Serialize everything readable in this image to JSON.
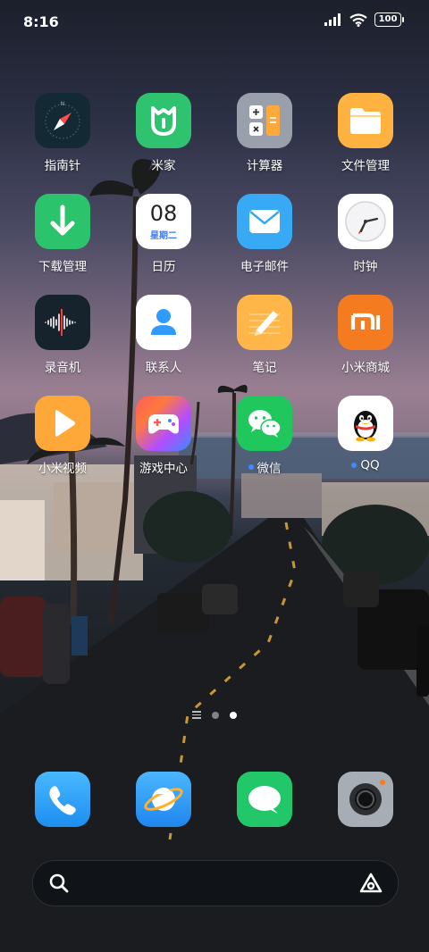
{
  "status_bar": {
    "time": "8:16",
    "battery": "100"
  },
  "apps": [
    {
      "label": "指南针",
      "icon": "compass-icon"
    },
    {
      "label": "米家",
      "icon": "mijia-icon"
    },
    {
      "label": "计算器",
      "icon": "calculator-icon"
    },
    {
      "label": "文件管理",
      "icon": "folder-icon"
    },
    {
      "label": "下载管理",
      "icon": "download-icon"
    },
    {
      "label": "日历",
      "icon": "calendar-icon",
      "date_day": "08",
      "weekday": "星期二"
    },
    {
      "label": "电子邮件",
      "icon": "mail-icon"
    },
    {
      "label": "时钟",
      "icon": "clock-icon"
    },
    {
      "label": "录音机",
      "icon": "recorder-icon"
    },
    {
      "label": "联系人",
      "icon": "contacts-icon"
    },
    {
      "label": "笔记",
      "icon": "notes-icon"
    },
    {
      "label": "小米商城",
      "icon": "mi-store-icon",
      "logo_text": "mi"
    },
    {
      "label": "小米视频",
      "icon": "video-play-icon"
    },
    {
      "label": "游戏中心",
      "icon": "gamepad-icon"
    },
    {
      "label": "微信",
      "icon": "wechat-icon"
    },
    {
      "label": "QQ",
      "icon": "qq-penguin-icon"
    }
  ],
  "dock": [
    {
      "name": "phone",
      "icon": "phone-icon"
    },
    {
      "name": "browser",
      "icon": "browser-planet-icon"
    },
    {
      "name": "messages",
      "icon": "message-bubble-icon"
    },
    {
      "name": "camera",
      "icon": "camera-icon"
    }
  ],
  "pager": {
    "pages": 2,
    "active_index": 1
  },
  "colors": {
    "wechat_badge": "#3d8bff",
    "qq_badge": "#3d8bff"
  }
}
